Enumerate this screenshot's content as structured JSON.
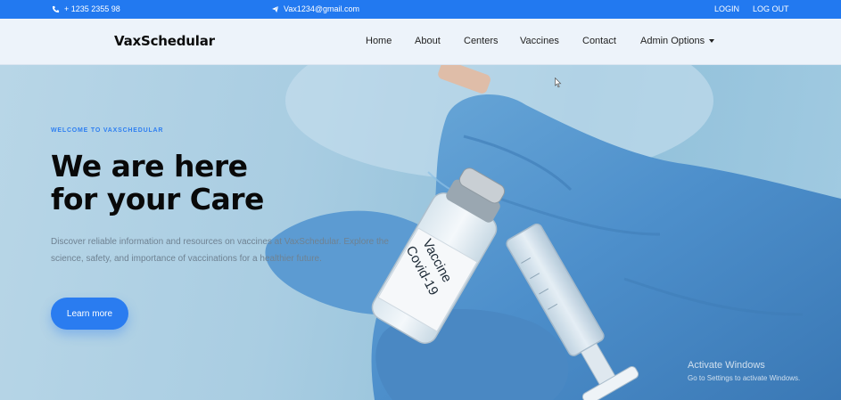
{
  "topbar": {
    "phone": "+ 1235 2355 98",
    "email": "Vax1234@gmail.com",
    "login": "LOGIN",
    "logout": "LOG OUT",
    "icons": {
      "phone": "phone-icon",
      "email": "paper-plane-icon"
    }
  },
  "navbar": {
    "brand": "VaxSchedular",
    "links": {
      "home": "Home",
      "about": "About",
      "centers": "Centers",
      "vaccines": "Vaccines",
      "contact": "Contact",
      "admin": "Admin Options"
    }
  },
  "hero": {
    "eyebrow": "WELCOME TO VAXSCHEDULAR",
    "headline_line1": "We are here",
    "headline_line2": "for your Care",
    "description": "Discover reliable information and resources on vaccines at VaxSchedular. Explore the science, safety, and importance of vaccinations for a healthier future.",
    "cta": "Learn more",
    "vial_label_line1": "Vaccine",
    "vial_label_line2": "Covid-19"
  },
  "watermark": {
    "line1": "Activate Windows",
    "line2": "Go to Settings to activate Windows."
  },
  "colors": {
    "accent": "#2279f0",
    "button": "#2a7cf0",
    "heading": "#090909",
    "navbar_bg": "#edf3fa",
    "hero_bg": "#a9cde2"
  }
}
